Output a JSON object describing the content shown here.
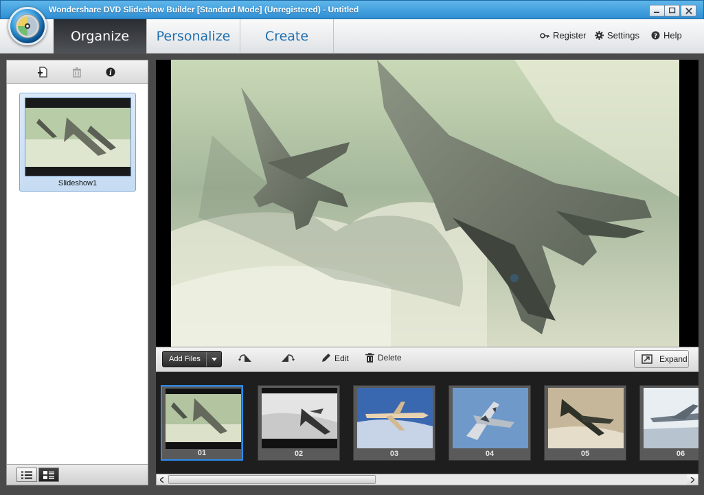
{
  "window": {
    "title": "Wondershare DVD Slideshow Builder [Standard Mode] (Unregistered) - Untitled",
    "controls": [
      "minimize",
      "maximize",
      "close"
    ]
  },
  "tabs": [
    {
      "label": "Organize",
      "active": true
    },
    {
      "label": "Personalize",
      "active": false
    },
    {
      "label": "Create",
      "active": false
    }
  ],
  "top_links": {
    "register": "Register",
    "settings": "Settings",
    "help": "Help"
  },
  "left_panel": {
    "tools": [
      "add-slideshow-icon",
      "delete-slideshow-icon",
      "info-icon"
    ],
    "slideshows": [
      {
        "label": "Slideshow1"
      }
    ],
    "view_modes": [
      "list-view-icon",
      "thumbnail-view-icon"
    ]
  },
  "edit_toolbar": {
    "add_files": "Add Files",
    "edit": "Edit",
    "delete": "Delete",
    "expand": "Expand"
  },
  "filmstrip": [
    {
      "num": "01",
      "selected": true
    },
    {
      "num": "02",
      "selected": false
    },
    {
      "num": "03",
      "selected": false
    },
    {
      "num": "04",
      "selected": false
    },
    {
      "num": "05",
      "selected": false
    },
    {
      "num": "06",
      "selected": false
    }
  ],
  "colors": {
    "title_bar": "#2f8fd3",
    "active_tab": "#2a2d31",
    "tab_text": "#1f6fae",
    "selection": "#2d8cf0"
  }
}
